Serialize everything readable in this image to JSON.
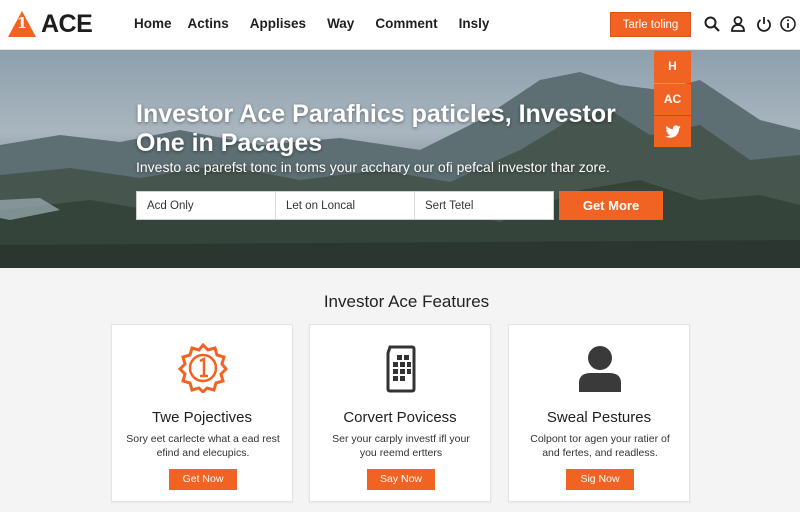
{
  "header": {
    "logo_mark": "1",
    "logo_text": "ACE",
    "nav": [
      "Home",
      "Actins",
      "Applises",
      "Way",
      "Comment",
      "Insly"
    ],
    "cta_label": "Tarle toling",
    "icons": [
      "search-icon",
      "user-icon",
      "power-icon",
      "info-icon"
    ]
  },
  "hero": {
    "title": "Investor Ace Parafhics paticles, Investor One in Pacages",
    "subtitle": "Investo ac parefst tonc in toms your acchary our ofi pefcal investor thar zore.",
    "search_fields": [
      "Acd Only",
      "Let on Loncal",
      "Sert Tetel"
    ],
    "button_label": "Get More",
    "social": [
      "H",
      "AC",
      "twitter-icon"
    ]
  },
  "features": {
    "title": "Investor Ace Features",
    "cards": [
      {
        "icon": "badge-icon",
        "title": "Twe Pojectives",
        "text": "Sory eet carlecte what a ead rest efind and elecupics.",
        "button": "Get Now"
      },
      {
        "icon": "phone-grid-icon",
        "title": "Corvert Povicess",
        "text": "Ser your carply investf ifl your you reemd ertters",
        "button": "Say Now"
      },
      {
        "icon": "person-icon",
        "title": "Sweal Pestures",
        "text": "Colpont tor agen your ratier of and fertes, and readless.",
        "button": "Sig Now"
      }
    ]
  },
  "colors": {
    "accent": "#f16322",
    "header_bg": "#ffffff",
    "page_bg": "#f4f4f4"
  }
}
